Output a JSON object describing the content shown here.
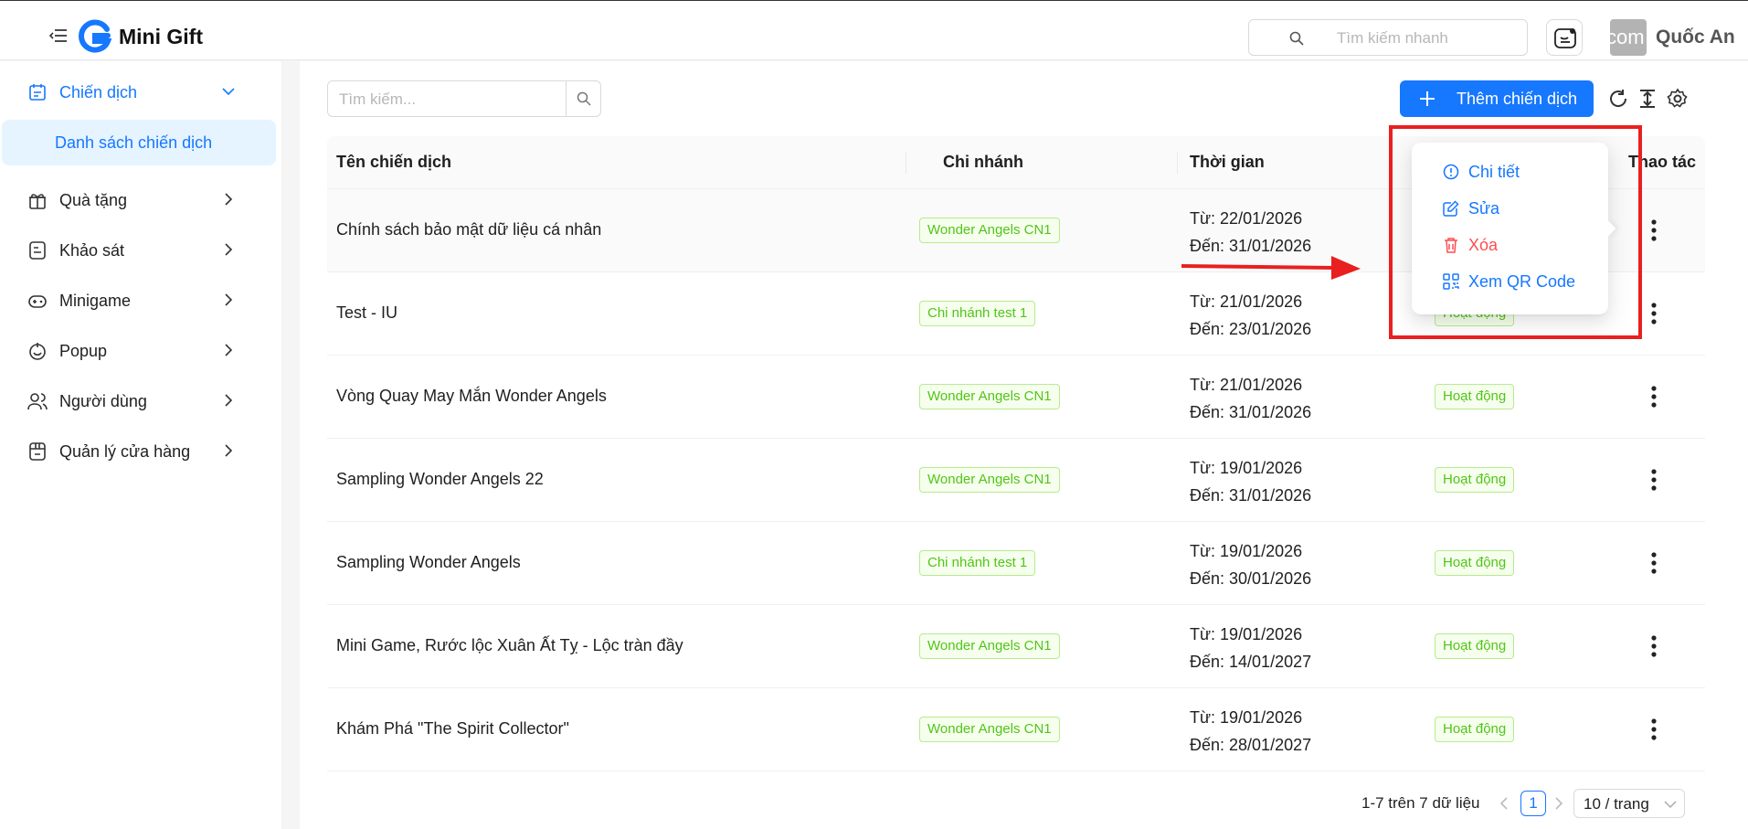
{
  "header": {
    "logo_text": "Mini Gift",
    "quick_search_placeholder": "Tìm kiếm nhanh",
    "avatar_text": "com",
    "user_name": "Quốc An"
  },
  "sidebar": {
    "items": [
      {
        "label": "Chiến dịch",
        "icon": "campaign-icon"
      },
      {
        "label": "Quà tặng",
        "icon": "gift-icon"
      },
      {
        "label": "Khảo sát",
        "icon": "survey-icon"
      },
      {
        "label": "Minigame",
        "icon": "gamepad-icon"
      },
      {
        "label": "Popup",
        "icon": "popup-icon"
      },
      {
        "label": "Người dùng",
        "icon": "users-icon"
      },
      {
        "label": "Quản lý cửa hàng",
        "icon": "store-icon"
      }
    ],
    "sub_item": "Danh sách chiến dịch"
  },
  "toolbar": {
    "search_placeholder": "Tìm kiếm...",
    "add_label": "Thêm chiến dịch"
  },
  "table": {
    "columns": [
      "Tên chiến dịch",
      "Chi nhánh",
      "Thời gian",
      "Thao tác"
    ],
    "rows": [
      {
        "name": "Chính sách bảo mật dữ liệu cá nhân",
        "branch": "Wonder Angels CN1",
        "from": "Từ: 22/01/2026",
        "to": "Đến: 31/01/2026",
        "status": ""
      },
      {
        "name": "Test - IU",
        "branch": "Chi nhánh test 1",
        "from": "Từ: 21/01/2026",
        "to": "Đến: 23/01/2026",
        "status": "Hoạt động"
      },
      {
        "name": "Vòng Quay May Mắn Wonder Angels",
        "branch": "Wonder Angels CN1",
        "from": "Từ: 21/01/2026",
        "to": "Đến: 31/01/2026",
        "status": "Hoạt động"
      },
      {
        "name": "Sampling Wonder Angels 22",
        "branch": "Wonder Angels CN1",
        "from": "Từ: 19/01/2026",
        "to": "Đến: 31/01/2026",
        "status": "Hoạt động"
      },
      {
        "name": "Sampling Wonder Angels",
        "branch": "Chi nhánh test 1",
        "from": "Từ: 19/01/2026",
        "to": "Đến: 30/01/2026",
        "status": "Hoạt động"
      },
      {
        "name": "Mini Game, Rước lộc Xuân Ất Tỵ - Lộc tràn đầy",
        "branch": "Wonder Angels CN1",
        "from": "Từ: 19/01/2026",
        "to": "Đến: 14/01/2027",
        "status": "Hoạt động"
      },
      {
        "name": "Khám Phá \"The Spirit Collector\"",
        "branch": "Wonder Angels CN1",
        "from": "Từ: 19/01/2026",
        "to": "Đến: 28/01/2027",
        "status": "Hoạt động"
      }
    ]
  },
  "dropdown": {
    "items": [
      {
        "label": "Chi tiết",
        "icon": "info-icon"
      },
      {
        "label": "Sửa",
        "icon": "edit-icon"
      },
      {
        "label": "Xóa",
        "icon": "trash-icon"
      },
      {
        "label": "Xem QR Code",
        "icon": "qr-code-icon"
      }
    ]
  },
  "pagination": {
    "summary": "1-7 trên 7 dữ liệu",
    "current_page": "1",
    "page_size": "10 / trang"
  },
  "colors": {
    "primary": "#1677ff",
    "success": "#52c41a",
    "danger": "#ff4d4f",
    "highlight": "#e8201f"
  }
}
